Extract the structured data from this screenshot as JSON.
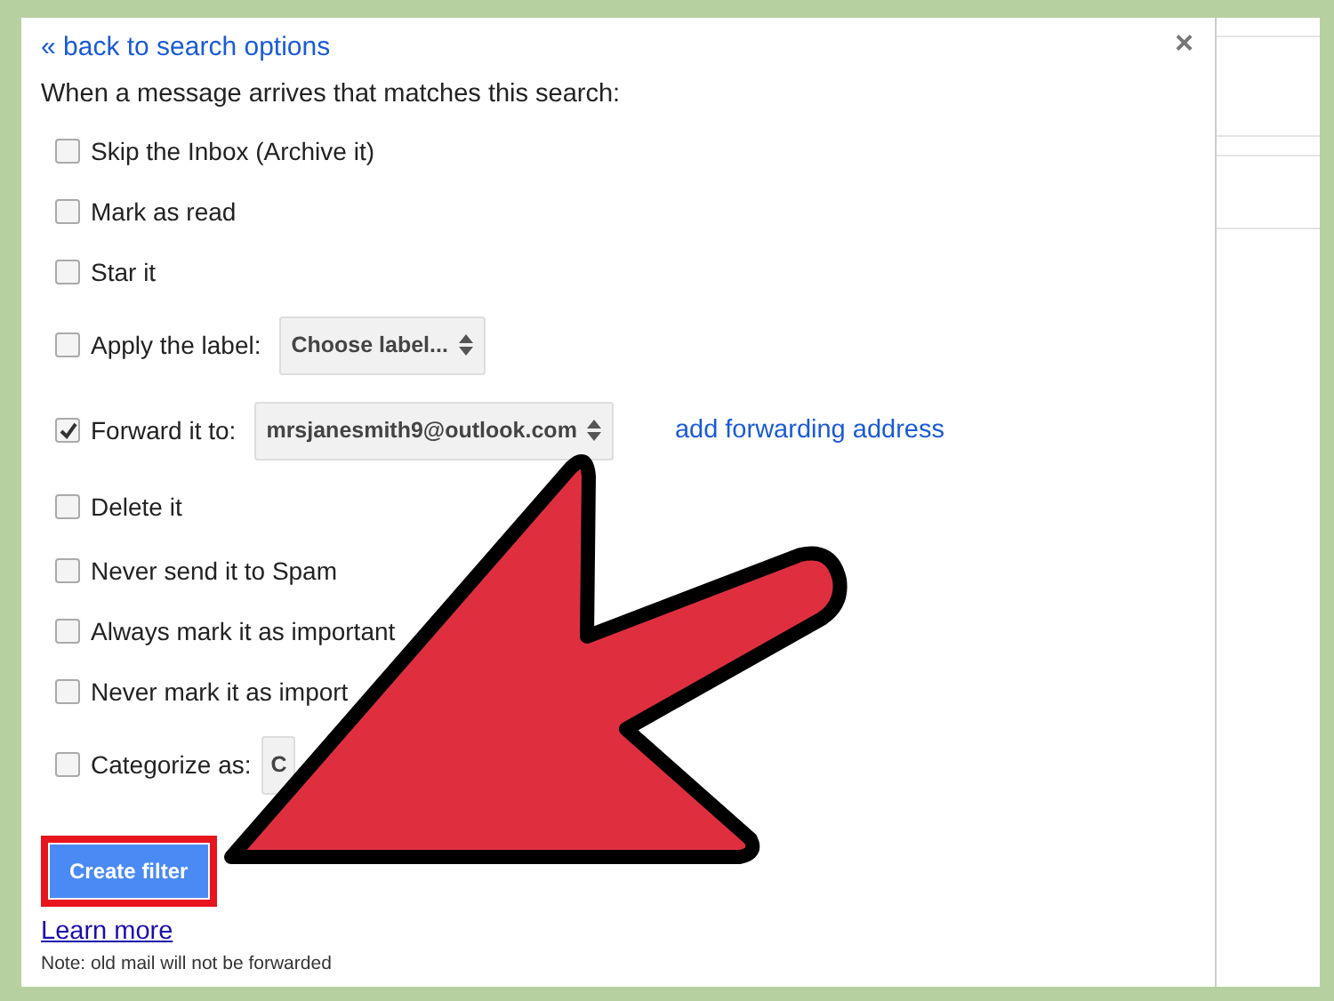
{
  "dialog": {
    "back_link": "« back to search options",
    "close": "×",
    "intro": "When a message arrives that matches this search:",
    "options": [
      {
        "kind": "plain",
        "label": "Skip the Inbox (Archive it)",
        "checked": false
      },
      {
        "kind": "plain",
        "label": "Mark as read",
        "checked": false
      },
      {
        "kind": "plain",
        "label": "Star it",
        "checked": false
      },
      {
        "kind": "select",
        "label": "Apply the label:",
        "checked": false,
        "select": "Choose label...",
        "select_arrows": true
      },
      {
        "kind": "select",
        "label": "Forward it to:",
        "checked": true,
        "select": "mrsjanesmith9@outlook.com",
        "select_arrows": true,
        "link": "add forwarding address"
      },
      {
        "kind": "plain",
        "label": "Delete it",
        "checked": false
      },
      {
        "kind": "plain",
        "label": "Never send it to Spam",
        "checked": false
      },
      {
        "kind": "plain",
        "label": "Always mark it as important",
        "checked": false
      },
      {
        "kind": "plain",
        "label": "Never mark it as import",
        "checked": false
      },
      {
        "kind": "select",
        "label": "Categorize as:",
        "checked": false,
        "select": "C",
        "select_arrows": false
      }
    ],
    "create_button": "Create filter",
    "learn_more": "Learn more",
    "note": "Note: old mail will not be forwarded"
  }
}
